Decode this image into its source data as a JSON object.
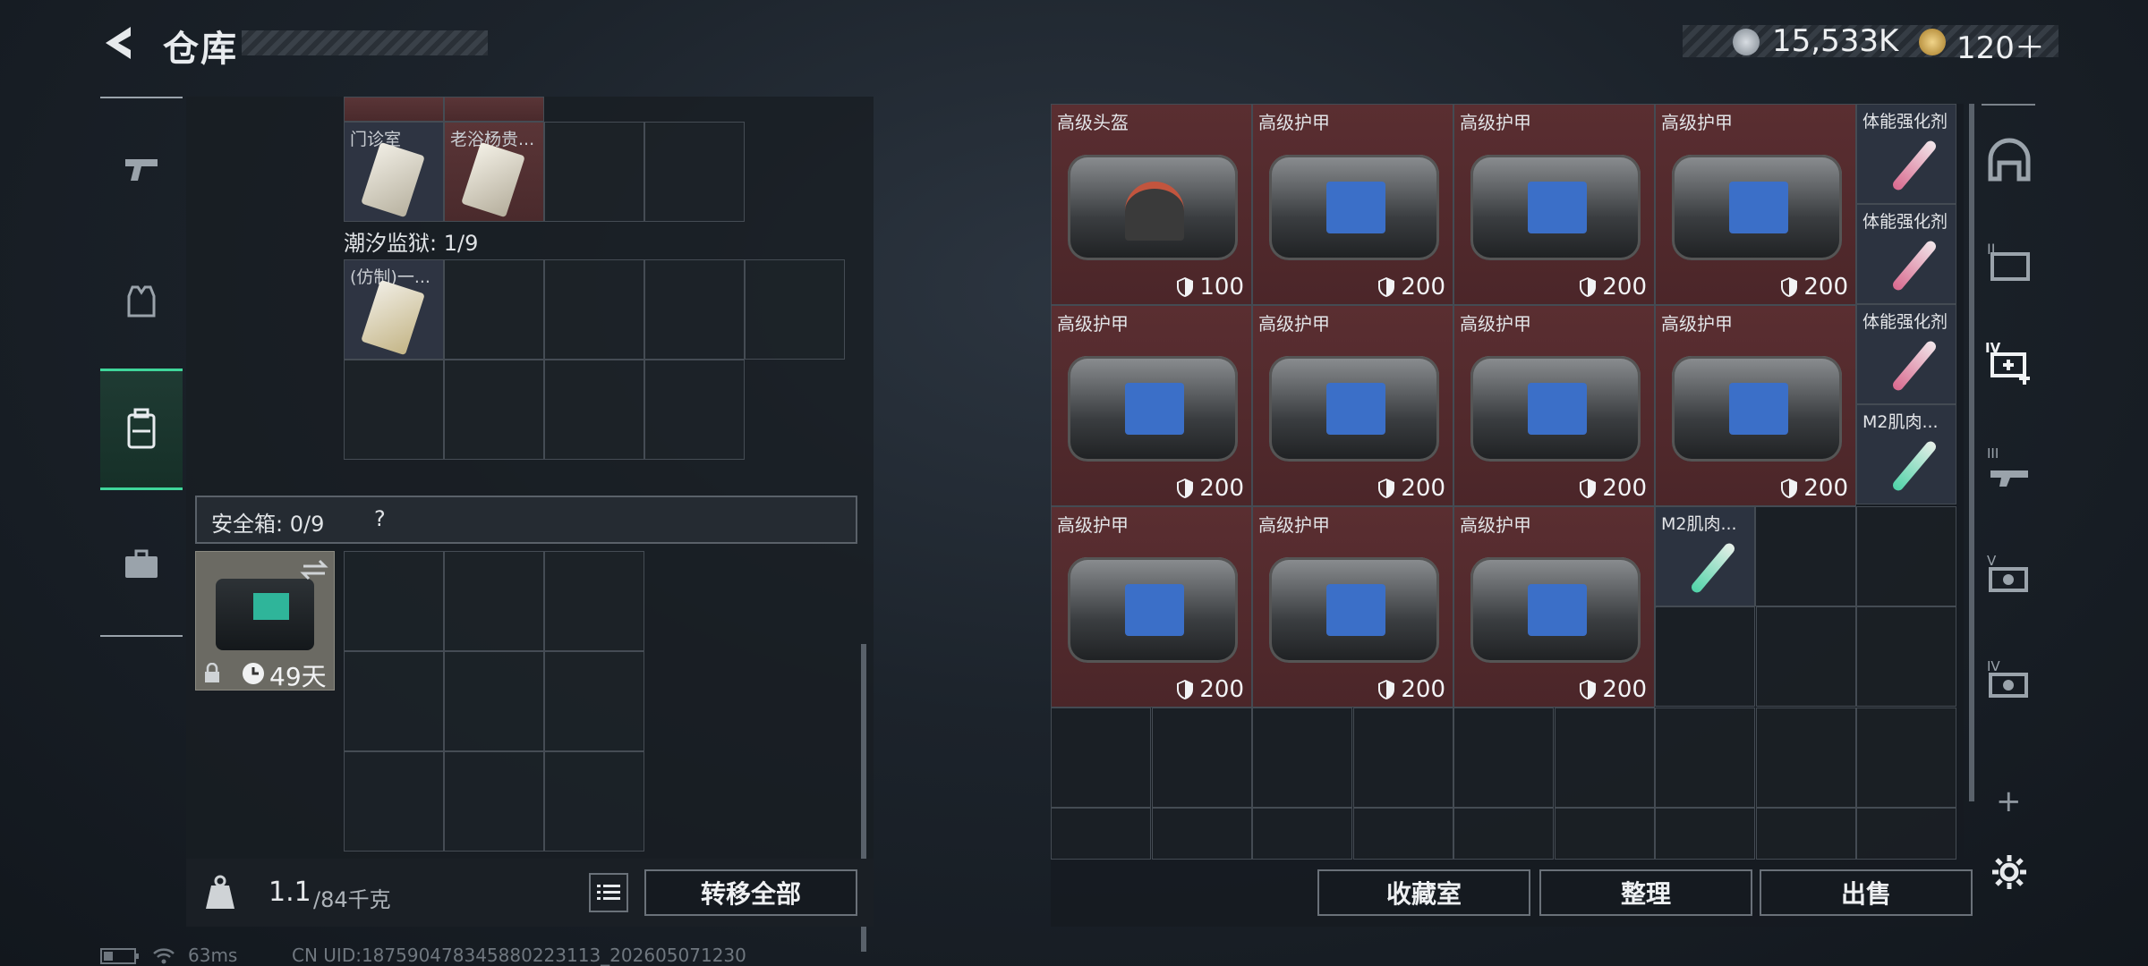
{
  "header": {
    "title": "仓库",
    "currency": [
      {
        "icon": "silver-coin-icon",
        "value": "15,533K"
      },
      {
        "icon": "gold-coin-icon",
        "value": "120＋"
      }
    ]
  },
  "left_panel": {
    "top_items": [
      {
        "label": "门诊室"
      },
      {
        "label": "老浴杨贵..."
      }
    ],
    "section2_title": "潮汐监狱: 1/9",
    "section2_items": [
      {
        "label": "(仿制)一..."
      }
    ],
    "safe_box": {
      "title": "安全箱: 0/9",
      "help": "?",
      "days": "49天"
    },
    "weight": {
      "current": "1.1",
      "max": "/84千克"
    },
    "transfer_all_label": "转移全部"
  },
  "right_panel": {
    "items": [
      {
        "label": "高级头盔",
        "durability": "100"
      },
      {
        "label": "高级护甲",
        "durability": "200"
      },
      {
        "label": "高级护甲",
        "durability": "200"
      },
      {
        "label": "高级护甲",
        "durability": "200"
      },
      {
        "label": "高级护甲",
        "durability": "200"
      },
      {
        "label": "高级护甲",
        "durability": "200"
      },
      {
        "label": "高级护甲",
        "durability": "200"
      },
      {
        "label": "高级护甲",
        "durability": "200"
      },
      {
        "label": "高级护甲",
        "durability": "200"
      },
      {
        "label": "高级护甲",
        "durability": "200"
      },
      {
        "label": "高级护甲",
        "durability": "200"
      }
    ],
    "small_items": [
      {
        "label": "体能强化剂"
      },
      {
        "label": "体能强化剂"
      },
      {
        "label": "体能强化剂"
      },
      {
        "label": "M2肌肉..."
      },
      {
        "label": "M2肌肉..."
      }
    ],
    "buttons": {
      "collection": "收藏室",
      "sort": "整理",
      "sell": "出售"
    }
  },
  "status_bar": {
    "ping": "63ms",
    "uid": "CN UID:187590478345880223113_202605071230"
  },
  "colors": {
    "accent": "#3fd69a",
    "item_bg": "#5a2e31",
    "panel_bg": "#181d23"
  }
}
